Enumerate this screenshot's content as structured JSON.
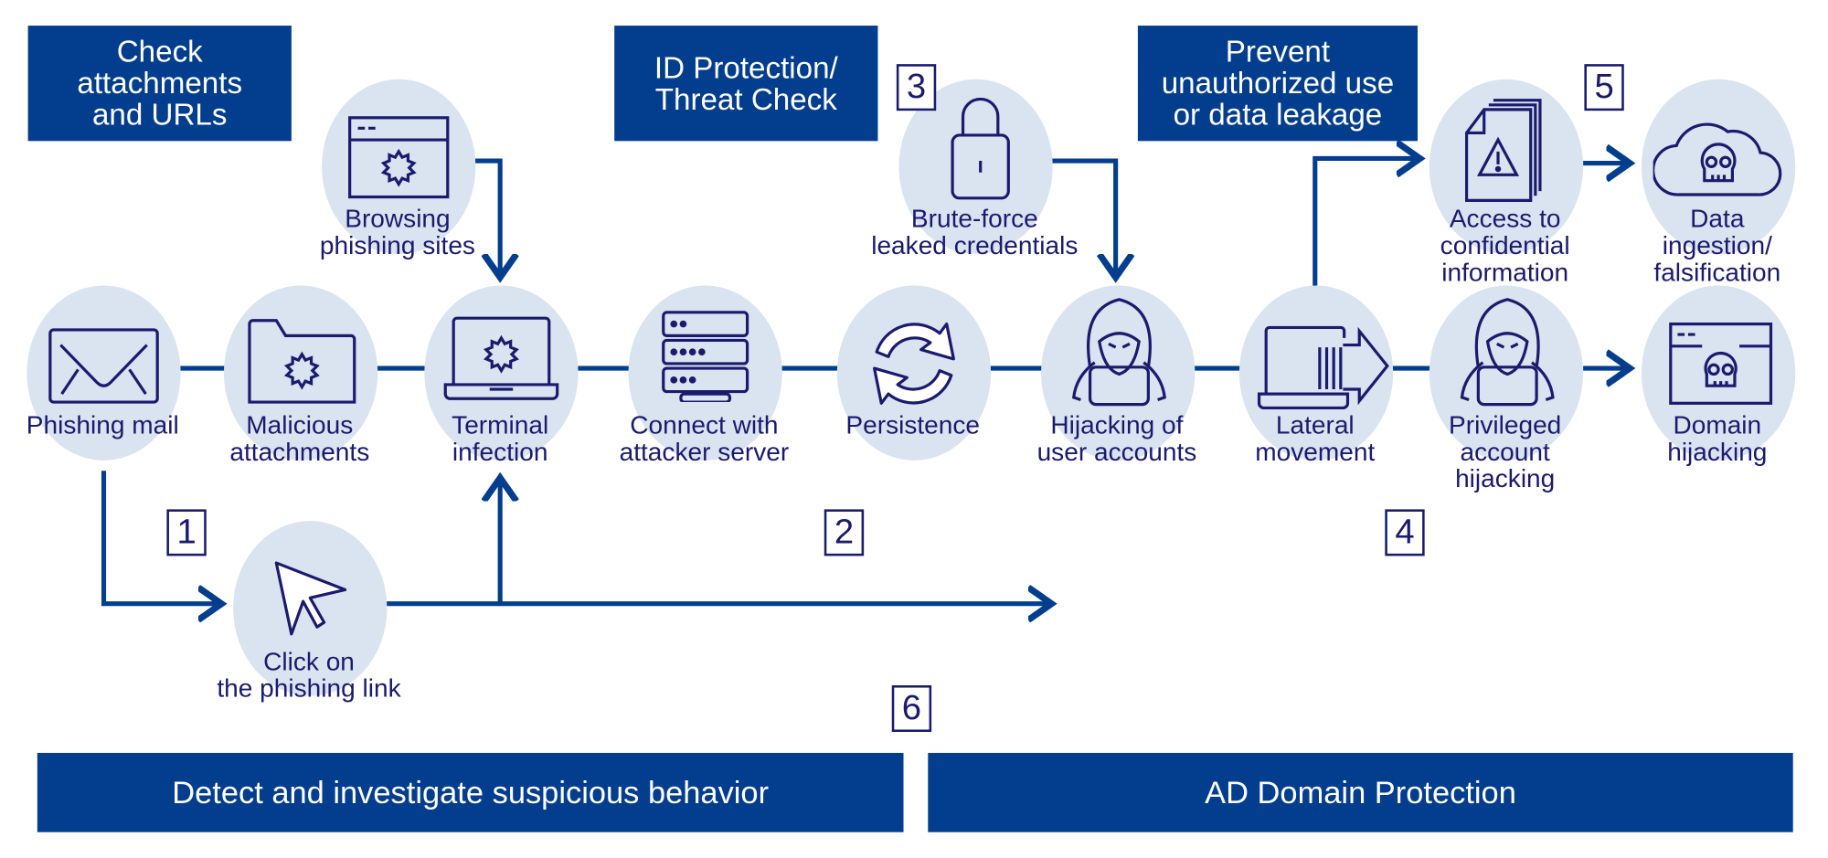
{
  "colors": {
    "accent_blue": "#023d8e",
    "node_fill": "#dae3f0",
    "icon_text_navy": "#1a1a6e",
    "background": "#ffffff"
  },
  "header_boxes": [
    {
      "id": "check",
      "text": "Check\nattachments\nand URLs"
    },
    {
      "id": "idprot",
      "text": "ID Protection/\nThreat Check"
    },
    {
      "id": "prevent",
      "text": "Prevent\nunauthorized use\nor data leakage"
    }
  ],
  "nodes": {
    "phishing_mail": {
      "label": "Phishing mail",
      "icon": "envelope-icon"
    },
    "malicious_attachments": {
      "label": "Malicious\nattachments",
      "icon": "folder-malware-icon"
    },
    "terminal_infection": {
      "label": "Terminal\ninfection",
      "icon": "laptop-malware-icon"
    },
    "browsing_phishing": {
      "label": "Browsing\nphishing sites",
      "icon": "browser-malware-icon"
    },
    "connect_server": {
      "label": "Connect with\nattacker server",
      "icon": "server-icon"
    },
    "persistence": {
      "label": "Persistence",
      "icon": "cycle-arrows-icon"
    },
    "brute_force": {
      "label": "Brute-force\nleaked credentials",
      "icon": "padlock-icon"
    },
    "hijack_user": {
      "label": "Hijacking of\nuser accounts",
      "icon": "hacker-icon"
    },
    "lateral": {
      "label": "Lateral\nmovement",
      "icon": "laptop-arrow-icon"
    },
    "privileged": {
      "label": "Privileged\naccount\nhijacking",
      "icon": "hacker-icon"
    },
    "confidential": {
      "label": "Access to\nconfidential\ninformation",
      "icon": "document-warning-icon"
    },
    "data_ingestion": {
      "label": "Data ingestion/\nfalsification",
      "icon": "cloud-skull-icon"
    },
    "domain_hijack": {
      "label": "Domain\nhijacking",
      "icon": "browser-skull-icon"
    },
    "click_link": {
      "label": "Click on\nthe phishing link",
      "icon": "cursor-icon"
    }
  },
  "step_numbers": [
    "1",
    "2",
    "3",
    "4",
    "5",
    "6"
  ],
  "bottom_bars": [
    {
      "id": "detect",
      "text": "Detect and investigate suspicious behavior"
    },
    {
      "id": "ad",
      "text": "AD Domain Protection"
    }
  ]
}
